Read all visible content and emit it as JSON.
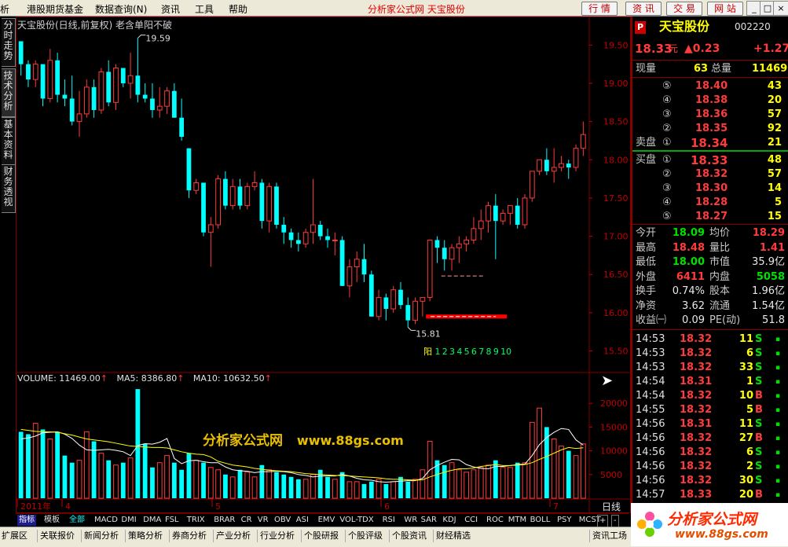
{
  "menu": {
    "items": [
      "析",
      "港股期货基金",
      "数据查询(N)",
      "资讯",
      "工具",
      "帮助"
    ],
    "center": "分析家公式网 天宝股份",
    "right_buttons": [
      "行 情",
      "资 讯",
      "交 易",
      "网 站"
    ],
    "win_buttons": [
      "_",
      "□",
      "×"
    ]
  },
  "left_tabs": [
    "分时走势",
    "技术分析",
    "基本资料",
    "财务透视"
  ],
  "chart": {
    "title": "天宝股份(日线,前复权) 老含单阳不破",
    "price_ticks": [
      "19.50",
      "19.00",
      "18.50",
      "18.00",
      "17.50",
      "17.00",
      "16.50",
      "16.00",
      "15.50"
    ],
    "high_label": "19.59",
    "low_label": "15.81",
    "yang_label": "阳",
    "yang_counts": [
      "1",
      "2",
      "3",
      "4",
      "5",
      "6",
      "7",
      "8",
      "9",
      "10"
    ],
    "volume_legend": {
      "vol": "VOLUME: 11469.00",
      "ma5": "MA5: 8386.80",
      "ma10": "MA10: 10632.50"
    },
    "vol_ticks": [
      "20000",
      "15000",
      "10000",
      "5000"
    ],
    "date_labels": [
      "2011年",
      "4",
      "5",
      "6",
      "7"
    ],
    "period": "日线",
    "watermark_cn": "分析家公式网",
    "watermark_url": "www.88gs.com",
    "colors": {
      "up": "#ff3b3b",
      "down": "#00ffff",
      "ma_white": "#ffffff",
      "ma_yellow": "#ffff00",
      "mark": "#ff0000"
    }
  },
  "chart_data": {
    "type": "candlestick",
    "note_series": "daily candles",
    "ohlc": [
      [
        19.55,
        19.5,
        19.1,
        19.25
      ],
      [
        19.25,
        19.3,
        18.95,
        19.05
      ],
      [
        19.05,
        19.3,
        18.95,
        19.25
      ],
      [
        19.25,
        19.2,
        18.7,
        18.8
      ],
      [
        18.8,
        19.45,
        18.75,
        19.3
      ],
      [
        19.3,
        19.4,
        18.75,
        18.85
      ],
      [
        18.85,
        19.05,
        18.7,
        18.8
      ],
      [
        18.8,
        19.1,
        18.45,
        18.5
      ],
      [
        18.5,
        18.9,
        18.3,
        18.6
      ],
      [
        18.6,
        19.05,
        18.55,
        18.95
      ],
      [
        18.95,
        19.05,
        18.55,
        18.65
      ],
      [
        18.65,
        19.2,
        18.6,
        19.15
      ],
      [
        19.15,
        19.3,
        18.7,
        18.75
      ],
      [
        18.75,
        19.25,
        18.65,
        19.2
      ],
      [
        19.2,
        19.2,
        18.95,
        19.0
      ],
      [
        19.0,
        19.4,
        18.8,
        19.1
      ],
      [
        19.1,
        19.59,
        18.75,
        18.85
      ],
      [
        18.85,
        19.0,
        18.75,
        18.8
      ],
      [
        18.8,
        19.0,
        18.55,
        18.65
      ],
      [
        18.65,
        18.95,
        18.55,
        18.7
      ],
      [
        18.7,
        18.95,
        18.6,
        18.9
      ],
      [
        18.9,
        19.0,
        18.55,
        18.55
      ],
      [
        18.55,
        18.8,
        18.25,
        18.3
      ],
      [
        18.15,
        18.15,
        17.5,
        17.6
      ],
      [
        17.6,
        17.75,
        17.55,
        17.7
      ],
      [
        17.7,
        17.7,
        17.0,
        17.05
      ],
      [
        17.05,
        17.25,
        16.6,
        17.15
      ],
      [
        17.15,
        17.8,
        17.1,
        17.75
      ],
      [
        17.75,
        17.85,
        17.35,
        17.4
      ],
      [
        17.4,
        17.75,
        17.35,
        17.65
      ],
      [
        17.65,
        17.75,
        17.35,
        17.4
      ],
      [
        17.4,
        17.7,
        17.35,
        17.65
      ],
      [
        17.65,
        17.85,
        17.6,
        17.7
      ],
      [
        17.7,
        17.75,
        17.1,
        17.2
      ],
      [
        17.2,
        17.7,
        17.05,
        17.65
      ],
      [
        17.65,
        17.7,
        17.1,
        17.15
      ],
      [
        17.15,
        17.25,
        16.9,
        17.05
      ],
      [
        17.05,
        17.1,
        16.85,
        16.95
      ],
      [
        16.95,
        17.05,
        16.8,
        16.9
      ],
      [
        16.9,
        17.1,
        16.85,
        17.05
      ],
      [
        17.05,
        17.75,
        16.9,
        17.15
      ],
      [
        17.15,
        17.2,
        16.95,
        17.0
      ],
      [
        17.0,
        17.1,
        16.85,
        16.95
      ],
      [
        16.95,
        17.05,
        16.75,
        16.95
      ],
      [
        16.95,
        17.0,
        16.35,
        16.35
      ],
      [
        16.35,
        16.7,
        16.2,
        16.6
      ],
      [
        16.6,
        16.8,
        16.4,
        16.7
      ],
      [
        16.7,
        16.9,
        16.4,
        16.5
      ],
      [
        16.5,
        16.55,
        15.95,
        15.95
      ],
      [
        15.95,
        16.3,
        15.9,
        16.2
      ],
      [
        16.2,
        16.25,
        15.9,
        16.05
      ],
      [
        16.05,
        16.35,
        16.0,
        16.3
      ],
      [
        16.3,
        16.4,
        16.05,
        16.1
      ],
      [
        16.1,
        16.2,
        15.81,
        15.9
      ],
      [
        15.9,
        16.2,
        15.85,
        16.15
      ],
      [
        16.15,
        16.2,
        15.95,
        16.2
      ],
      [
        16.2,
        16.95,
        16.15,
        16.95
      ],
      [
        16.95,
        17.0,
        16.65,
        16.85
      ],
      [
        16.85,
        16.95,
        16.55,
        16.7
      ],
      [
        16.7,
        16.9,
        16.55,
        16.85
      ],
      [
        16.85,
        17.0,
        16.65,
        16.9
      ],
      [
        16.9,
        17.0,
        16.8,
        16.95
      ],
      [
        16.95,
        17.25,
        16.9,
        17.1
      ],
      [
        17.1,
        17.35,
        16.95,
        17.2
      ],
      [
        17.2,
        17.45,
        17.05,
        17.4
      ],
      [
        17.4,
        17.55,
        16.7,
        17.2
      ],
      [
        17.2,
        17.35,
        17.15,
        17.3
      ],
      [
        17.3,
        17.4,
        17.15,
        17.4
      ],
      [
        17.4,
        17.5,
        17.1,
        17.15
      ],
      [
        17.15,
        17.55,
        17.1,
        17.5
      ],
      [
        17.5,
        17.85,
        17.45,
        17.85
      ],
      [
        17.85,
        18.0,
        17.8,
        18.0
      ],
      [
        18.0,
        18.15,
        17.8,
        17.85
      ],
      [
        17.85,
        18.15,
        17.7,
        17.9
      ],
      [
        17.9,
        18.05,
        17.85,
        17.95
      ],
      [
        17.95,
        18.0,
        17.75,
        17.9
      ],
      [
        17.9,
        18.2,
        17.85,
        18.15
      ],
      [
        18.15,
        18.5,
        18.05,
        18.33
      ]
    ],
    "volume": [
      14000,
      13500,
      15800,
      14500,
      12500,
      14000,
      9000,
      7500,
      8000,
      14000,
      12000,
      9500,
      8000,
      7000,
      7500,
      8500,
      23000,
      11500,
      6500,
      7500,
      9000,
      7500,
      6000,
      9500,
      8000,
      7500,
      6500,
      6000,
      5000,
      4500,
      6000,
      5500,
      4500,
      7000,
      6000,
      5500,
      5000,
      4500,
      4000,
      4000,
      5000,
      6000,
      4500,
      4000,
      5500,
      3500,
      3500,
      3000,
      3500,
      4000,
      3000,
      3500,
      4500,
      3500,
      4000,
      6000,
      12000,
      8000,
      7000,
      7500,
      6000,
      5500,
      6000,
      6500,
      7000,
      8000,
      6500,
      6500,
      7500,
      7500,
      16000,
      19000,
      15000,
      12500,
      11000,
      10000,
      9000,
      11469
    ],
    "ma5": [
      12500,
      12700,
      13100,
      13800,
      13900,
      14000,
      13500,
      12600,
      11200,
      10200,
      10100,
      10200,
      10300,
      10100,
      9800,
      9000,
      11100,
      11500,
      11400,
      11800,
      12600,
      8400,
      7300,
      7900,
      8000,
      7700,
      7500,
      7500,
      6600,
      6000,
      5800,
      5700,
      5400,
      5600,
      5600,
      5700,
      5600,
      5400,
      5000,
      4800,
      4500,
      4700,
      4700,
      4700,
      5000,
      4700,
      4200,
      3900,
      3800,
      3500,
      3400,
      3500,
      3600,
      3700,
      3700,
      4200,
      6000,
      6900,
      7600,
      8200,
      8100,
      7100,
      6600,
      6300,
      6200,
      6700,
      6700,
      6900,
      7100,
      7200,
      9000,
      11300,
      12800,
      13900,
      14700,
      14500,
      12300,
      11200
    ],
    "ma10": [
      14500,
      14300,
      14100,
      14000,
      14000,
      13900,
      13600,
      13300,
      12900,
      12500,
      12300,
      12100,
      11900,
      11600,
      11300,
      11000,
      10900,
      10800,
      10700,
      10700,
      10600,
      10200,
      9800,
      9500,
      9300,
      9200,
      8700,
      7800,
      7400,
      7000,
      6800,
      6600,
      6300,
      6100,
      5900,
      5800,
      5700,
      5600,
      5400,
      5200,
      5100,
      5000,
      4900,
      4800,
      4800,
      4700,
      4600,
      4500,
      4400,
      4300,
      4100,
      4000,
      4000,
      3900,
      3800,
      3900,
      4500,
      5000,
      5500,
      5900,
      6200,
      6200,
      6400,
      6700,
      6900,
      7100,
      6900,
      6900,
      7000,
      7100,
      7500,
      8200,
      8800,
      9500,
      10200,
      10700,
      10500,
      10632
    ],
    "price_range": [
      15.3,
      19.75
    ],
    "volume_range": [
      0,
      25000
    ]
  },
  "stock": {
    "badge": "P",
    "name": "天宝股份",
    "code": "002220",
    "price": "18.33",
    "price_unit": "元",
    "change": "▲0.23",
    "pct": "+1.27",
    "volume_now_label": "现量",
    "volume_now": "63",
    "total_label": "总量",
    "total": "11469",
    "sell_label": "卖盘",
    "buy_label": "买盘",
    "asks": [
      {
        "n": "⑤",
        "p": "18.40",
        "v": "43"
      },
      {
        "n": "④",
        "p": "18.38",
        "v": "20"
      },
      {
        "n": "③",
        "p": "18.36",
        "v": "57"
      },
      {
        "n": "②",
        "p": "18.35",
        "v": "92"
      },
      {
        "n": "①",
        "p": "18.34",
        "v": "21"
      }
    ],
    "bids": [
      {
        "n": "①",
        "p": "18.33",
        "v": "48"
      },
      {
        "n": "②",
        "p": "18.32",
        "v": "57"
      },
      {
        "n": "③",
        "p": "18.30",
        "v": "14"
      },
      {
        "n": "④",
        "p": "18.28",
        "v": "5"
      },
      {
        "n": "⑤",
        "p": "18.27",
        "v": "15"
      }
    ],
    "stats": [
      {
        "l1": "今开",
        "v1": "18.09",
        "c1": "grn",
        "l2": "均价",
        "v2": "18.29",
        "c2": "red"
      },
      {
        "l1": "最高",
        "v1": "18.48",
        "c1": "red",
        "l2": "量比",
        "v2": "1.41",
        "c2": "red"
      },
      {
        "l1": "最低",
        "v1": "18.00",
        "c1": "grn",
        "l2": "市值",
        "v2": "35.9亿",
        "c2": "wht"
      },
      {
        "l1": "外盘",
        "v1": "6411",
        "c1": "red",
        "l2": "内盘",
        "v2": "5058",
        "c2": "grn"
      },
      {
        "l1": "换手",
        "v1": "0.74%",
        "c1": "wht",
        "l2": "股本",
        "v2": "1.96亿",
        "c2": "wht"
      },
      {
        "l1": "净资",
        "v1": "3.62",
        "c1": "wht",
        "l2": "流通",
        "v2": "1.54亿",
        "c2": "wht"
      },
      {
        "l1": "收益㈠",
        "v1": "0.09",
        "c1": "wht",
        "l2": "PE(动)",
        "v2": "51.8",
        "c2": "wht"
      }
    ],
    "trades": [
      {
        "t": "14:53",
        "p": "18.32",
        "v": "11",
        "s": "S"
      },
      {
        "t": "14:53",
        "p": "18.32",
        "v": "6",
        "s": "S"
      },
      {
        "t": "14:53",
        "p": "18.32",
        "v": "33",
        "s": "S"
      },
      {
        "t": "14:54",
        "p": "18.31",
        "v": "1",
        "s": "S"
      },
      {
        "t": "14:54",
        "p": "18.32",
        "v": "10",
        "s": "B"
      },
      {
        "t": "14:55",
        "p": "18.32",
        "v": "5",
        "s": "B"
      },
      {
        "t": "14:56",
        "p": "18.31",
        "v": "11",
        "s": "S"
      },
      {
        "t": "14:56",
        "p": "18.32",
        "v": "27",
        "s": "B"
      },
      {
        "t": "14:56",
        "p": "18.32",
        "v": "6",
        "s": "S"
      },
      {
        "t": "14:56",
        "p": "18.32",
        "v": "2",
        "s": "S"
      },
      {
        "t": "14:56",
        "p": "18.32",
        "v": "30",
        "s": "S"
      },
      {
        "t": "14:57",
        "p": "18.33",
        "v": "20",
        "s": "B"
      }
    ]
  },
  "indicator_tabs": [
    "指标",
    "模板",
    "全部",
    "MACD",
    "DMI",
    "DMA",
    "FSL",
    "TRIX",
    "BRAR",
    "CR",
    "VR",
    "OBV",
    "ASI",
    "EMV",
    "VOL-TDX",
    "RSI",
    "WR",
    "SAR",
    "KDJ",
    "CCI",
    "ROC",
    "MTM",
    "BOLL",
    "PSY",
    "MCST"
  ],
  "indicator_right": [
    "+",
    "-"
  ],
  "bottom_tabs": [
    "扩展区",
    "关联报价",
    "新闻分析",
    "策略分析",
    "券商分析",
    "产业分析",
    "行业分析",
    "个股研报",
    "个股评级",
    "个股资讯",
    "财经精选",
    "资讯工场"
  ],
  "logo": {
    "text": "分析家公式网",
    "url": "www.88gs.com"
  }
}
